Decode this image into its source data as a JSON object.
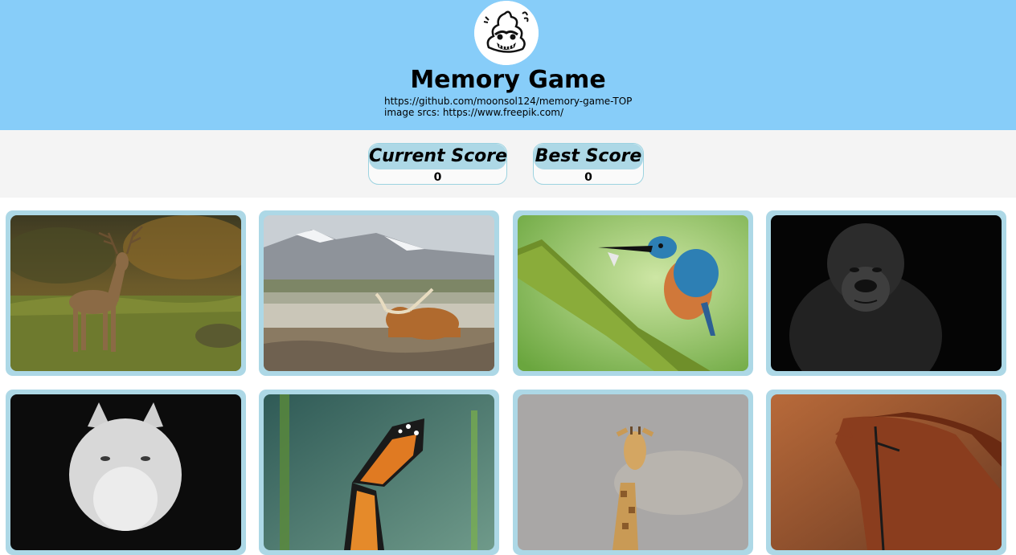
{
  "header": {
    "logo_icon": "poop-logo-icon",
    "title": "Memory Game",
    "repo_link": "https://github.com/moonsol124/memory-game-TOP",
    "image_sources": "image srcs: https://www.freepik.com/"
  },
  "scores": {
    "current_label": "Current Score",
    "current_value": "0",
    "best_label": "Best Score",
    "best_value": "0"
  },
  "cards": [
    {
      "subject": "red-deer-in-meadow"
    },
    {
      "subject": "highland-cow-by-mountains"
    },
    {
      "subject": "kingfisher-with-fish-on-mossy-branch"
    },
    {
      "subject": "gorilla-black-and-white"
    },
    {
      "subject": "white-wolf"
    },
    {
      "subject": "monarch-butterfly"
    },
    {
      "subject": "giraffe"
    },
    {
      "subject": "chestnut-horse-with-bridle"
    }
  ],
  "colors": {
    "header_bg": "#87cdf9",
    "scorebar_bg": "#f4f4f4",
    "card_frame": "#add8e6"
  }
}
